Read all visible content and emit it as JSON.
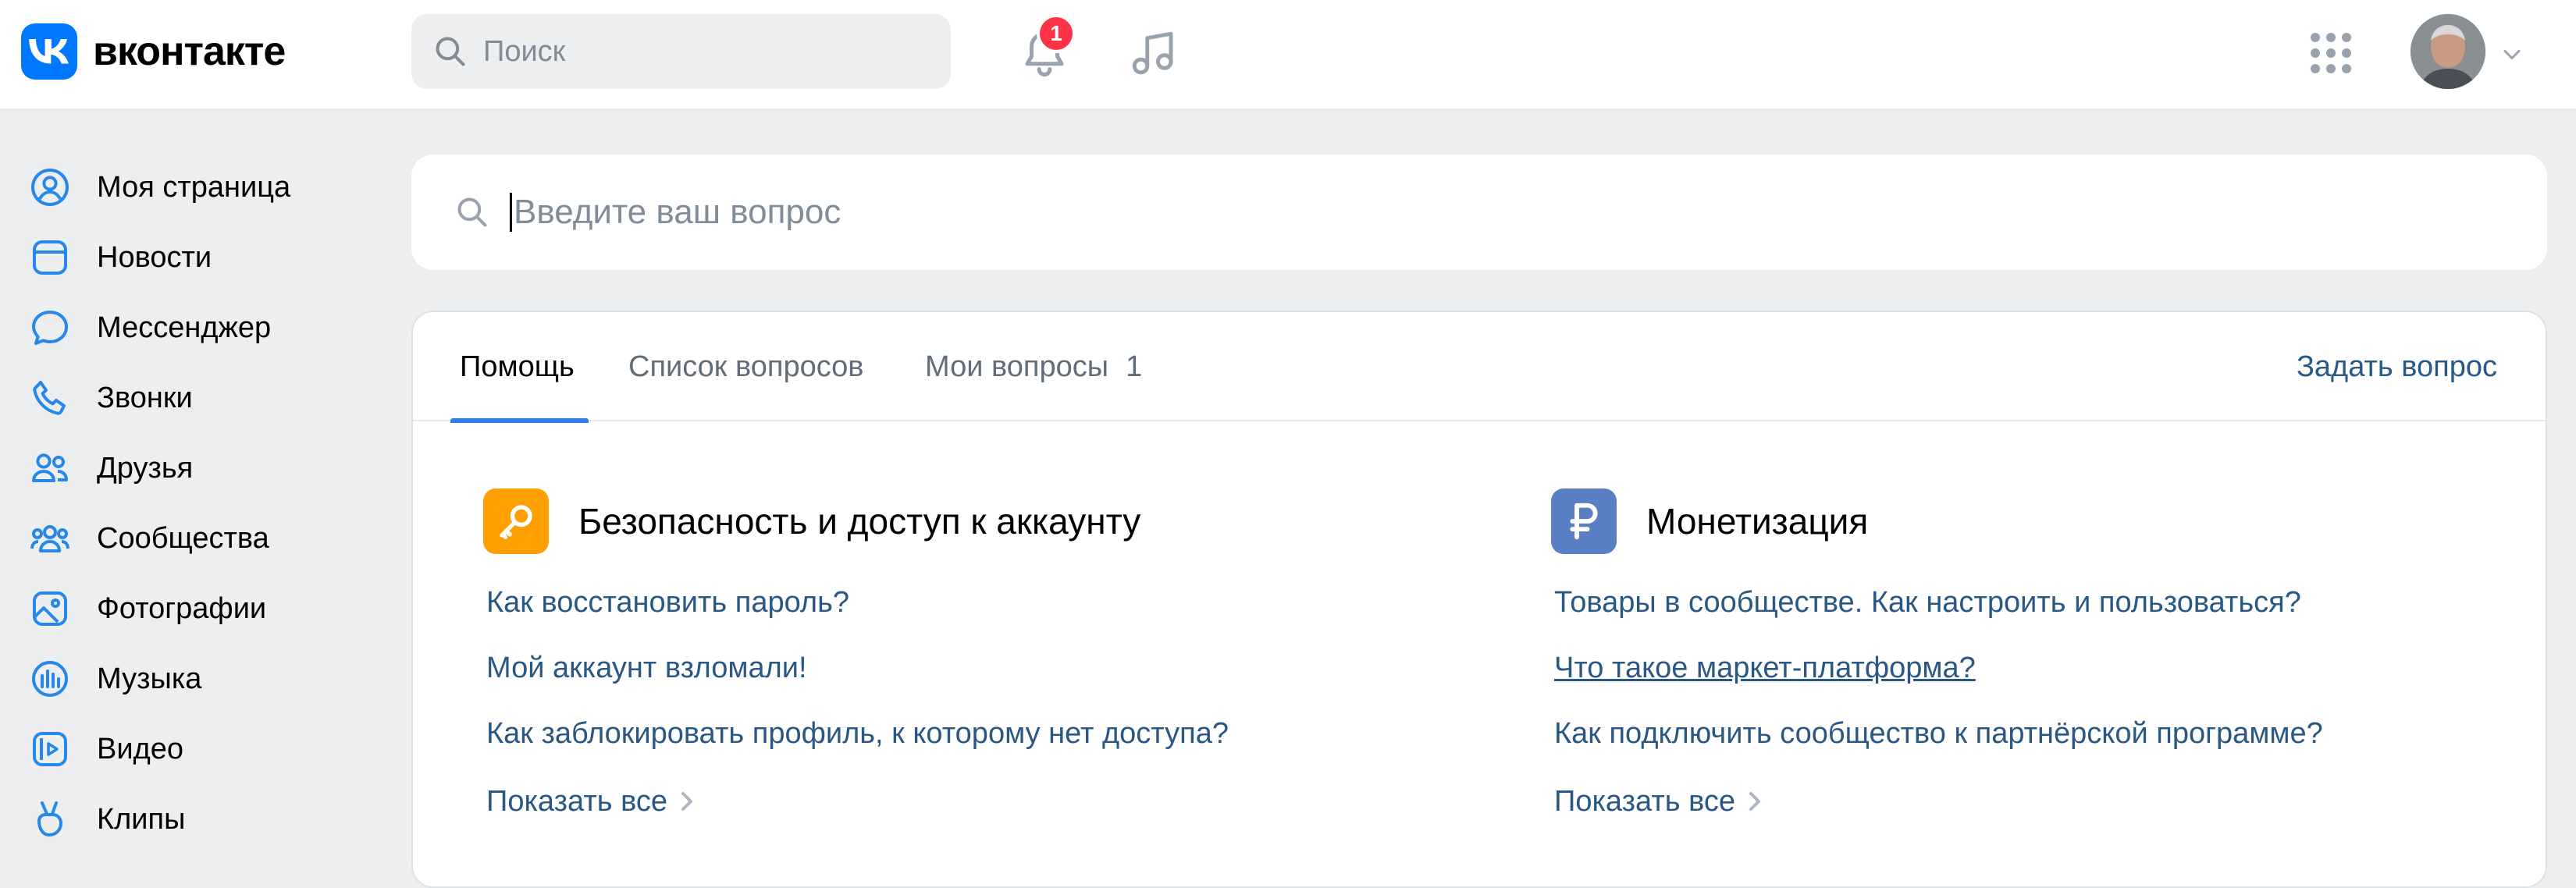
{
  "header": {
    "logo_text": "вконтакте",
    "search_placeholder": "Поиск",
    "notifications_badge": "1"
  },
  "sidebar": {
    "items": [
      {
        "label": "Моя страница",
        "icon": "user-circle-icon"
      },
      {
        "label": "Новости",
        "icon": "news-icon"
      },
      {
        "label": "Мессенджер",
        "icon": "message-icon"
      },
      {
        "label": "Звонки",
        "icon": "phone-icon"
      },
      {
        "label": "Друзья",
        "icon": "friends-icon"
      },
      {
        "label": "Сообщества",
        "icon": "communities-icon"
      },
      {
        "label": "Фотографии",
        "icon": "photo-icon"
      },
      {
        "label": "Музыка",
        "icon": "music-bars-icon"
      },
      {
        "label": "Видео",
        "icon": "video-icon"
      },
      {
        "label": "Клипы",
        "icon": "clips-icon"
      }
    ]
  },
  "question_search": {
    "placeholder": "Введите ваш вопрос"
  },
  "tabs": {
    "help": "Помощь",
    "questions_list": "Список вопросов",
    "my_questions": "Мои вопросы",
    "my_questions_count": "1",
    "ask": "Задать вопрос"
  },
  "sections": [
    {
      "title": "Безопасность и доступ к аккаунту",
      "icon": "key-icon",
      "color": "#ffa000",
      "links": [
        "Как восстановить пароль?",
        "Мой аккаунт взломали!",
        "Как заблокировать профиль, к которому нет доступа?"
      ],
      "show_all": "Показать все"
    },
    {
      "title": "Монетизация",
      "icon": "ruble-icon",
      "color": "#5b7fc4",
      "links": [
        "Товары в сообществе. Как настроить и пользоваться?",
        "Что такое маркет-платформа?",
        "Как подключить сообщество к партнёрской программе?"
      ],
      "show_all": "Показать все"
    }
  ],
  "colors": {
    "accent": "#2d81e0",
    "link": "#2a5885",
    "brand": "#0077ff",
    "badge": "#ff3347"
  }
}
